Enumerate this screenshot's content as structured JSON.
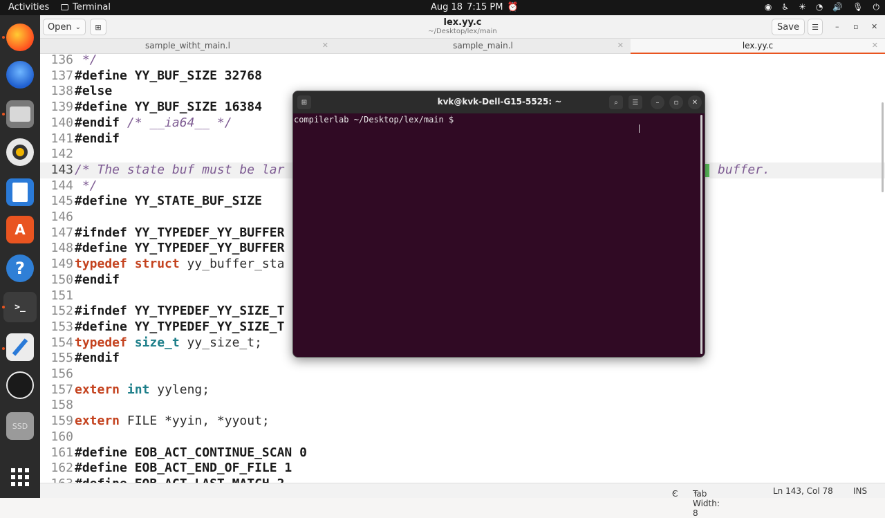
{
  "topbar": {
    "activities": "Activities",
    "app": "Terminal",
    "date": "Aug 18",
    "time": "7:15 PM"
  },
  "dock": {
    "items": [
      "firefox-icon",
      "thunderbird-icon",
      "files-icon",
      "rhythmbox-icon",
      "writer-icon",
      "software-icon",
      "help-icon",
      "terminal-icon",
      "text-editor-icon",
      "obs-icon",
      "ssd-icon",
      "apps-grid-icon"
    ],
    "ssd_label": "SSD",
    "terminal_glyph": ">_"
  },
  "editor": {
    "open_label": "Open",
    "title": "lex.yy.c",
    "subtitle": "~/Desktop/lex/main",
    "save_label": "Save",
    "tabs": [
      {
        "label": "sample_witht_main.l"
      },
      {
        "label": "sample_main.l"
      },
      {
        "label": "lex.yy.c"
      }
    ],
    "lines": [
      {
        "n": "136",
        "t": " */"
      },
      {
        "n": "137",
        "t": "#define YY_BUF_SIZE 32768"
      },
      {
        "n": "138",
        "t": "#else"
      },
      {
        "n": "139",
        "t": "#define YY_BUF_SIZE 16384"
      },
      {
        "n": "140",
        "t": "#endif"
      },
      {
        "n": "141",
        "t": "#endif"
      },
      {
        "n": "142",
        "t": ""
      },
      {
        "n": "143",
        "t": "/* The state buf must be lar"
      },
      {
        "n": "144",
        "t": " */"
      },
      {
        "n": "145",
        "t": "#define YY_STATE_BUF_SIZE"
      },
      {
        "n": "146",
        "t": ""
      },
      {
        "n": "147",
        "t": "#ifndef YY_TYPEDEF_YY_BUFFER"
      },
      {
        "n": "148",
        "t": "#define YY_TYPEDEF_YY_BUFFER"
      },
      {
        "n": "149",
        "t": "typedef"
      },
      {
        "n": "150",
        "t": "#endif"
      },
      {
        "n": "151",
        "t": ""
      },
      {
        "n": "152",
        "t": "#ifndef YY_TYPEDEF_YY_SIZE_T"
      },
      {
        "n": "153",
        "t": "#define YY_TYPEDEF_YY_SIZE_T"
      },
      {
        "n": "154",
        "t": "typedef"
      },
      {
        "n": "155",
        "t": "#endif"
      },
      {
        "n": "156",
        "t": ""
      },
      {
        "n": "157",
        "t": "extern"
      },
      {
        "n": "158",
        "t": ""
      },
      {
        "n": "159",
        "t": "extern"
      },
      {
        "n": "160",
        "t": ""
      },
      {
        "n": "161",
        "t": "#define EOB_ACT_CONTINUE_SCAN 0"
      },
      {
        "n": "162",
        "t": "#define EOB_ACT_END_OF_FILE 1"
      },
      {
        "n": "163",
        "t": "#define EOB_ACT_LAST_MATCH 2"
      }
    ],
    "line140_comment": " /* __ia64__ */",
    "line143_tail": "buffer.",
    "line149": {
      "kw2": " struct",
      "rest": " yy_buffer_sta"
    },
    "line154": {
      "type": " size_t",
      "rest": " yy_size_t;"
    },
    "line157": {
      "type": " int",
      "rest": " yyleng;"
    },
    "line159": {
      "rest": " FILE *yyin, *yyout;"
    },
    "status": {
      "lang": "C",
      "tab_width": "Tab Width: 8",
      "position": "Ln 143, Col 78",
      "mode": "INS"
    }
  },
  "terminal": {
    "title": "kvk@kvk-Dell-G15-5525: ~",
    "prompt": "compilerlab ~/Desktop/lex/main $ "
  },
  "colors": {
    "accent": "#e95420",
    "terminal_bg": "#300a24",
    "keyword": "#c4421e",
    "type": "#1e7f8a",
    "comment": "#7e5c93"
  }
}
